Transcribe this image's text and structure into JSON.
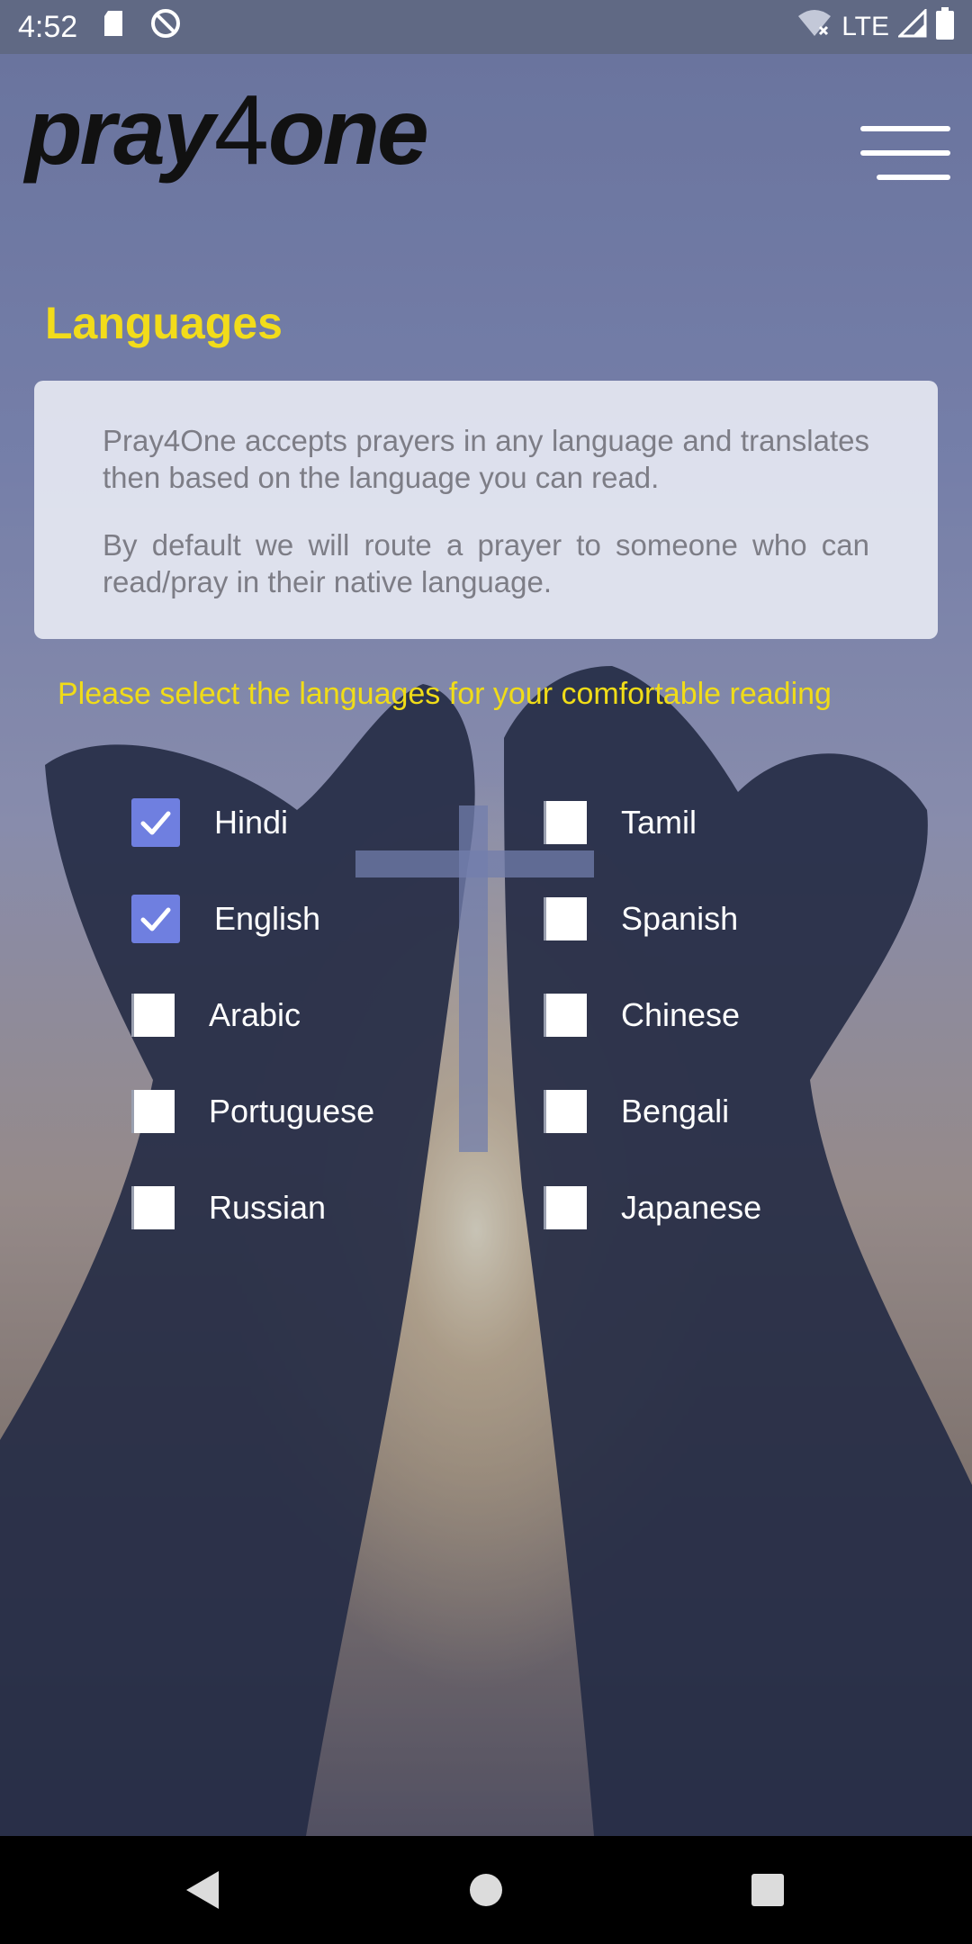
{
  "status_bar": {
    "time": "4:52",
    "network": "LTE",
    "icons": [
      "sd-card-icon",
      "do-not-disturb-icon",
      "wifi-off-icon",
      "signal-icon",
      "battery-icon"
    ]
  },
  "app": {
    "logo_part1": "pray",
    "logo_part2": "4",
    "logo_part3": "one"
  },
  "page": {
    "title": "Languages",
    "info_paragraph_1": "Pray4One accepts prayers in any language and translates then based on the language you can read.",
    "info_paragraph_2": "By default we will route a prayer to someone who can read/pray in their native language.",
    "prompt": "Please select the languages for your comfortable reading"
  },
  "languages": [
    {
      "label": "Hindi",
      "checked": true
    },
    {
      "label": "Tamil",
      "checked": false
    },
    {
      "label": "English",
      "checked": true
    },
    {
      "label": "Spanish",
      "checked": false
    },
    {
      "label": "Arabic",
      "checked": false
    },
    {
      "label": "Chinese",
      "checked": false
    },
    {
      "label": "Portuguese",
      "checked": false
    },
    {
      "label": "Bengali",
      "checked": false
    },
    {
      "label": "Russian",
      "checked": false
    },
    {
      "label": "Japanese",
      "checked": false
    }
  ],
  "colors": {
    "accent_yellow": "#f2dc1a",
    "checkbox_checked": "#6f7fe0"
  }
}
